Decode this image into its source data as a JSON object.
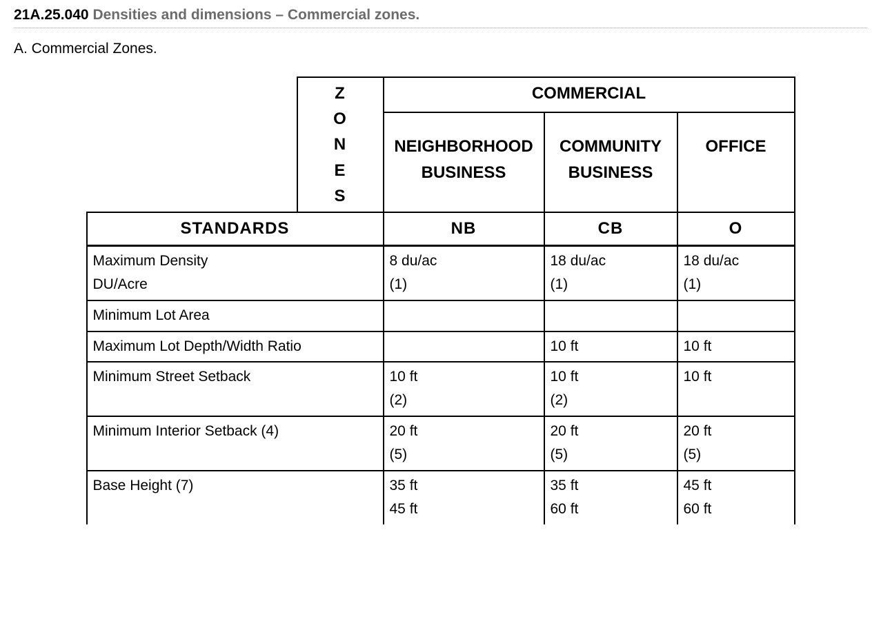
{
  "heading_code": "21A.25.040",
  "heading_text": "Densities and dimensions – Commercial zones.",
  "section_a": "A. Commercial Zones.",
  "hdr": {
    "zones_letters": [
      "Z",
      "O",
      "N",
      "E",
      "S"
    ],
    "commercial": "COMMERCIAL",
    "col_nb_long": "NEIGHBORHOOD BUSINESS",
    "col_cb_long": "COMMUNITY BUSINESS",
    "col_o_long": "OFFICE",
    "standards": "STANDARDS",
    "nb": "NB",
    "cb": "CB",
    "o": "O"
  },
  "rows": [
    {
      "label_l1": "Maximum Density",
      "label_l2": "DU/Acre",
      "nb_l1": "8 du/ac",
      "nb_l2": "(1)",
      "cb_l1": "18 du/ac",
      "cb_l2": "(1)",
      "o_l1": "18 du/ac",
      "o_l2": "(1)"
    },
    {
      "label_l1": "Minimum Lot Area",
      "label_l2": "",
      "nb_l1": "",
      "nb_l2": "",
      "cb_l1": "",
      "cb_l2": "",
      "o_l1": "",
      "o_l2": ""
    },
    {
      "label_l1": "Maximum Lot Depth/Width Ratio",
      "label_l2": "",
      "nb_l1": "",
      "nb_l2": "",
      "cb_l1": "10 ft",
      "cb_l2": "",
      "o_l1": "10 ft",
      "o_l2": ""
    },
    {
      "label_l1": "Minimum Street Setback",
      "label_l2": "",
      "nb_l1": "10 ft",
      "nb_l2": "(2)",
      "cb_l1": "10 ft",
      "cb_l2": "(2)",
      "o_l1": "10 ft",
      "o_l2": ""
    },
    {
      "label_l1": "Minimum Interior Setback (4)",
      "label_l2": "",
      "nb_l1": "20 ft",
      "nb_l2": "(5)",
      "cb_l1": "20 ft",
      "cb_l2": "(5)",
      "o_l1": "20 ft",
      "o_l2": "(5)"
    },
    {
      "label_l1": "Base Height (7)",
      "label_l2": "",
      "nb_l1": "35 ft",
      "nb_l2": "45 ft",
      "cb_l1": "35 ft",
      "cb_l2": "60 ft",
      "o_l1": "45 ft",
      "o_l2": "60 ft"
    }
  ],
  "chart_data": {
    "type": "table",
    "title": "21A.25.040 Densities and dimensions – Commercial zones",
    "columns": [
      "STANDARDS",
      "NB (Neighborhood Business)",
      "CB (Community Business)",
      "O (Office)"
    ],
    "rows": [
      [
        "Maximum Density DU/Acre",
        "8 du/ac (1)",
        "18 du/ac (1)",
        "18 du/ac (1)"
      ],
      [
        "Minimum Lot Area",
        "",
        "",
        ""
      ],
      [
        "Maximum Lot Depth/Width Ratio",
        "",
        "10 ft",
        "10 ft"
      ],
      [
        "Minimum Street Setback",
        "10 ft (2)",
        "10 ft (2)",
        "10 ft"
      ],
      [
        "Minimum Interior Setback (4)",
        "20 ft (5)",
        "20 ft (5)",
        "20 ft (5)"
      ],
      [
        "Base Height (7)",
        "35 ft / 45 ft",
        "35 ft / 60 ft",
        "45 ft / 60 ft"
      ]
    ]
  }
}
